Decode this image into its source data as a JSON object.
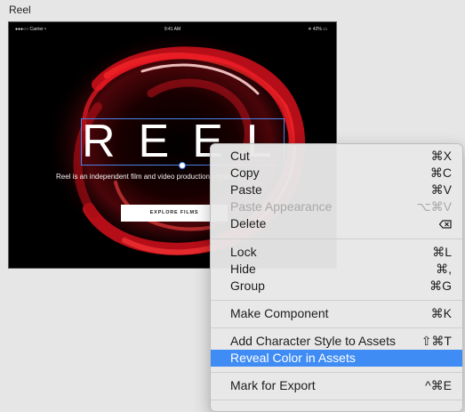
{
  "canvas": {
    "artboard_label": "Reel"
  },
  "device": {
    "carrier": "●●●○○ Carrier •",
    "time": "9:41 AM",
    "battery": "✳ 42% ▭"
  },
  "hero": {
    "title": "REEL",
    "tagline": "Reel is an independent film and video production company",
    "cta_label": "EXPLORE FILMS",
    "accent_color": "#c8101a"
  },
  "context_menu": {
    "items": [
      {
        "label": "Cut",
        "shortcut": "⌘X"
      },
      {
        "label": "Copy",
        "shortcut": "⌘C"
      },
      {
        "label": "Paste",
        "shortcut": "⌘V"
      },
      {
        "label": "Paste Appearance",
        "shortcut": "⌥⌘V",
        "disabled": true
      },
      {
        "label": "Delete",
        "shortcut_icon": "delete-key-icon"
      },
      {
        "label": "Lock",
        "shortcut": "⌘L"
      },
      {
        "label": "Hide",
        "shortcut": "⌘,"
      },
      {
        "label": "Group",
        "shortcut": "⌘G"
      },
      {
        "label": "Make Component",
        "shortcut": "⌘K"
      },
      {
        "label": "Add Character Style to Assets",
        "shortcut": "⇧⌘T"
      },
      {
        "label": "Reveal Color in Assets",
        "shortcut": "",
        "highlighted": true
      },
      {
        "label": "Mark for Export",
        "shortcut": "^⌘E"
      }
    ],
    "highlight_color": "#3f8cf5"
  }
}
